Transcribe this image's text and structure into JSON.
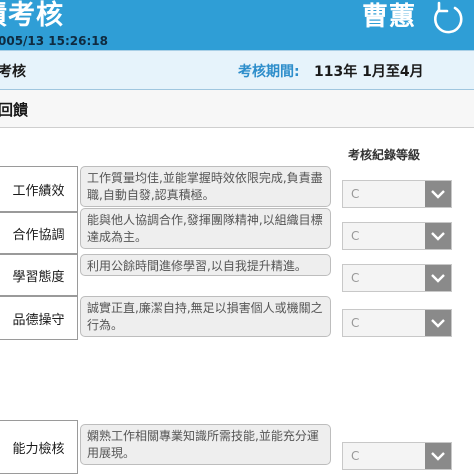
{
  "header": {
    "title": "績考核",
    "timestamp": "005/13 15:26:18",
    "username": "曹蕙"
  },
  "period_bar": {
    "section_label": "考核",
    "period_label": "考核期間:",
    "period_value": "113年 1月至4月"
  },
  "feedback": {
    "heading": "回饋"
  },
  "grade_column_header": "考核紀錄等級",
  "rows": [
    {
      "label": "工作績效",
      "description": "工作質量均佳,並能掌握時效依限完成,負責盡職,自動自發,認真積極。",
      "grade": "C"
    },
    {
      "label": "合作協調",
      "description": "能與他人協調合作,發揮團隊精神,以組織目標達成為主。",
      "grade": "C"
    },
    {
      "label": "學習態度",
      "description": "利用公餘時間進修學習,以自我提升精進。",
      "grade": "C"
    },
    {
      "label": "品德操守",
      "description": "誠實正直,廉潔自持,無足以損害個人或機關之行為。",
      "grade": "C"
    },
    {
      "label": "能力檢核",
      "description": "嫻熟工作相關專業知識所需技能,並能充分運用展現。",
      "grade": "C"
    }
  ],
  "icons": {
    "refresh": "refresh-icon",
    "dropdown": "chevron-down-icon"
  },
  "colors": {
    "header_bg": "#2f9ed6",
    "period_bar_bg": "#e6f3fb",
    "period_label": "#2e8ecb",
    "dropdown_arrow_bg": "#8a8a8a"
  }
}
